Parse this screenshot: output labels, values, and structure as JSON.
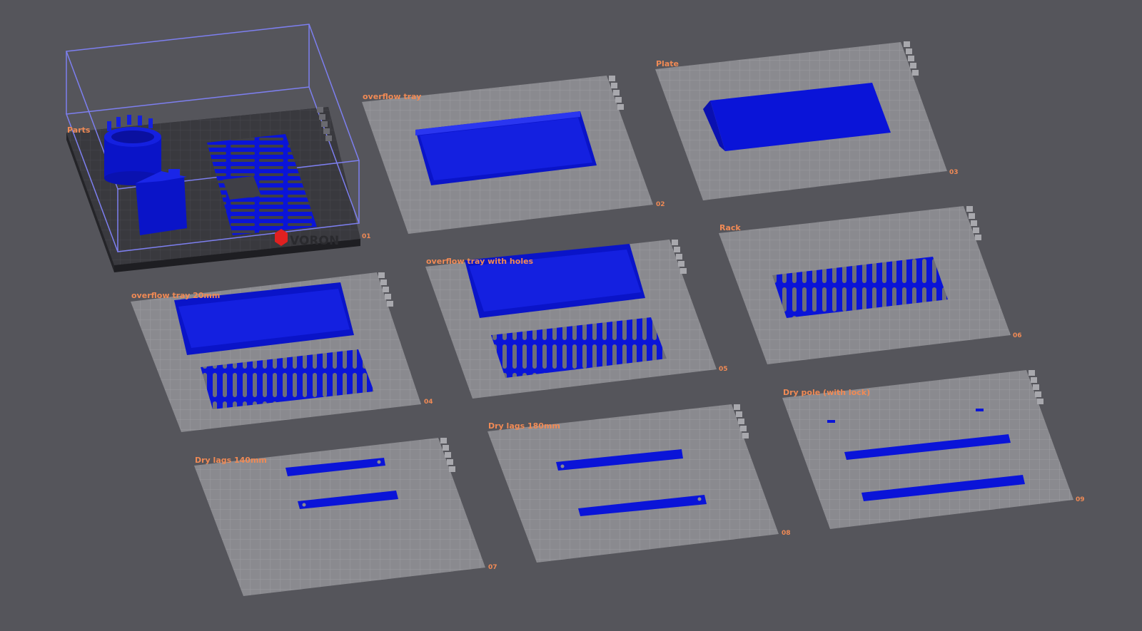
{
  "app": {
    "background": "#55555b",
    "accent": "#f08a55",
    "part_color": "#0a14d8"
  },
  "plates": [
    {
      "id": "01",
      "label": "Parts",
      "number": "01",
      "active": true,
      "brand": "VORON"
    },
    {
      "id": "02",
      "label": "overflow tray",
      "number": "02"
    },
    {
      "id": "03",
      "label": "Plate",
      "number": "03"
    },
    {
      "id": "04",
      "label": "overflow tray 20mm",
      "number": "04"
    },
    {
      "id": "05",
      "label": "overflow tray with holes",
      "number": "05"
    },
    {
      "id": "06",
      "label": "Rack",
      "number": "06"
    },
    {
      "id": "07",
      "label": "Dry lags 140mm",
      "number": "07"
    },
    {
      "id": "08",
      "label": "Dry lags 180mm",
      "number": "08"
    },
    {
      "id": "09",
      "label": "Dry pole (with lock)",
      "number": "09"
    }
  ],
  "plate_icons": [
    "close-icon",
    "lock-icon",
    "arrange-icon",
    "orient-icon",
    "settings-icon"
  ]
}
